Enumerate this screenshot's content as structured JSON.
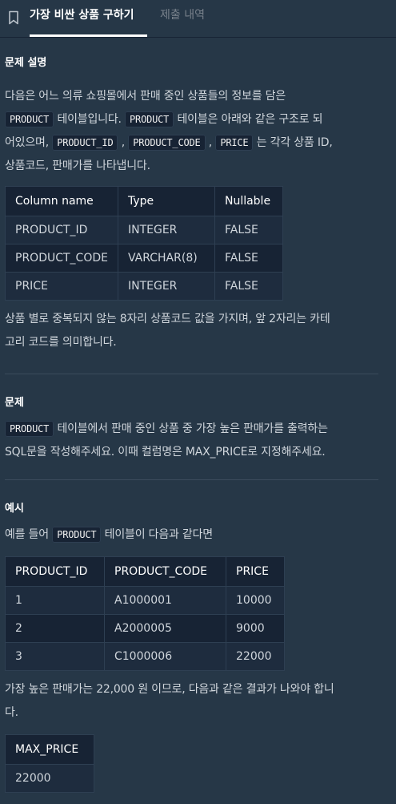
{
  "tabs": {
    "active_label": "가장 비싼 상품 구하기",
    "inactive_label": "제출 내역"
  },
  "description": {
    "heading": "문제 설명",
    "p1": {
      "line1": "다음은 어느 의류 쇼핑몰에서 판매 중인 상품들의 정보를 담은",
      "code_product_a": "PRODUCT",
      "text_a": " 테이블입니다. ",
      "code_product_b": "PRODUCT",
      "text_b": " 테이블은 아래와 같은 구조로 되",
      "text_c": "어있으며, ",
      "code_id": "PRODUCT_ID",
      "comma1": " , ",
      "code_code": "PRODUCT_CODE",
      "comma2": " , ",
      "code_price": "PRICE",
      "text_d": " 는 각각 상품 ID,",
      "line4": "상품코드, 판매가를 나타냅니다."
    },
    "schema_table": {
      "headers": [
        "Column name",
        "Type",
        "Nullable"
      ],
      "rows": [
        [
          "PRODUCT_ID",
          "INTEGER",
          "FALSE"
        ],
        [
          "PRODUCT_CODE",
          "VARCHAR(8)",
          "FALSE"
        ],
        [
          "PRICE",
          "INTEGER",
          "FALSE"
        ]
      ]
    },
    "p2_line1": "상품 별로 중복되지 않는 8자리 상품코드 값을 가지며, 앞 2자리는 카테",
    "p2_line2": "고리 코드를 의미합니다."
  },
  "problem": {
    "heading": "문제",
    "code_product": "PRODUCT",
    "line1": " 테이블에서 판매 중인 상품 중 가장 높은 판매가를 출력하는",
    "line2": "SQL문을 작성해주세요. 이때 컬럼명은 MAX_PRICE로 지정해주세요."
  },
  "example": {
    "heading": "예시",
    "intro_a": "예를 들어 ",
    "code_product": "PRODUCT",
    "intro_b": " 테이블이 다음과 같다면",
    "data_table": {
      "headers": [
        "PRODUCT_ID",
        "PRODUCT_CODE",
        "PRICE"
      ],
      "rows": [
        [
          "1",
          "A1000001",
          "10000"
        ],
        [
          "2",
          "A2000005",
          "9000"
        ],
        [
          "3",
          "C1000006",
          "22000"
        ]
      ]
    },
    "result_line1": "가장 높은 판매가는 22,000 원 이므로, 다음과 같은 결과가 나와야 합니",
    "result_line2": "다.",
    "result_table": {
      "headers": [
        "MAX_PRICE"
      ],
      "rows": [
        [
          "22000"
        ]
      ]
    }
  }
}
